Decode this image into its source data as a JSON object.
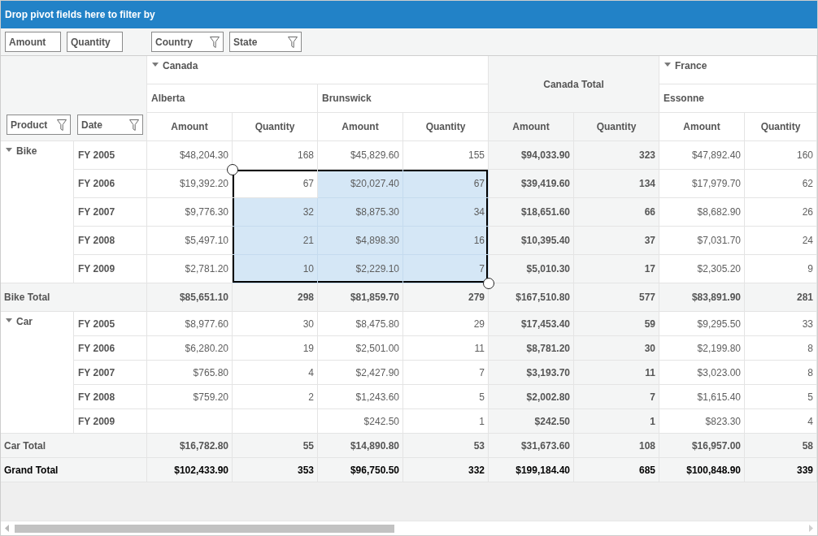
{
  "filter_area": {
    "title": "Drop pivot fields here to filter by"
  },
  "value_fields": [
    {
      "label": "Amount"
    },
    {
      "label": "Quantity"
    }
  ],
  "column_fields": [
    {
      "label": "Country"
    },
    {
      "label": "State"
    }
  ],
  "row_fields": [
    {
      "label": "Product"
    },
    {
      "label": "Date"
    }
  ],
  "column_groups": [
    {
      "kind": "country",
      "label": "Canada",
      "expanded": true,
      "states": [
        {
          "label": "Alberta",
          "measures": [
            "Amount",
            "Quantity"
          ]
        },
        {
          "label": "Brunswick",
          "measures": [
            "Amount",
            "Quantity"
          ]
        }
      ]
    },
    {
      "kind": "total",
      "label": "Canada Total",
      "measures": [
        "Amount",
        "Quantity"
      ]
    },
    {
      "kind": "country",
      "label": "France",
      "expanded": true,
      "states": [
        {
          "label": "Essonne",
          "measures": [
            "Amount",
            "Quantity"
          ]
        }
      ]
    }
  ],
  "row_groups": [
    {
      "label": "Bike",
      "expanded": true,
      "rows": [
        {
          "label": "FY 2005",
          "cells": [
            {
              "text": "$48,204.30",
              "selected": false
            },
            {
              "text": "168",
              "selected": false
            },
            {
              "text": "$45,829.60",
              "selected": false
            },
            {
              "text": "155",
              "selected": false
            },
            {
              "text": "$94,033.90",
              "selected": false
            },
            {
              "text": "323",
              "selected": false
            },
            {
              "text": "$47,892.40",
              "selected": false
            },
            {
              "text": "160",
              "selected": false
            }
          ]
        },
        {
          "label": "FY 2006",
          "cells": [
            {
              "text": "$19,392.20",
              "selected": false
            },
            {
              "text": "67",
              "selected": false
            },
            {
              "text": "$20,027.40",
              "selected": true
            },
            {
              "text": "67",
              "selected": true
            },
            {
              "text": "$39,419.60",
              "selected": false
            },
            {
              "text": "134",
              "selected": false
            },
            {
              "text": "$17,979.70",
              "selected": false
            },
            {
              "text": "62",
              "selected": false
            }
          ]
        },
        {
          "label": "FY 2007",
          "cells": [
            {
              "text": "$9,776.30",
              "selected": false
            },
            {
              "text": "32",
              "selected": true
            },
            {
              "text": "$8,875.30",
              "selected": true
            },
            {
              "text": "34",
              "selected": true
            },
            {
              "text": "$18,651.60",
              "selected": false
            },
            {
              "text": "66",
              "selected": false
            },
            {
              "text": "$8,682.90",
              "selected": false
            },
            {
              "text": "26",
              "selected": false
            }
          ]
        },
        {
          "label": "FY 2008",
          "cells": [
            {
              "text": "$5,497.10",
              "selected": false
            },
            {
              "text": "21",
              "selected": true
            },
            {
              "text": "$4,898.30",
              "selected": true
            },
            {
              "text": "16",
              "selected": true
            },
            {
              "text": "$10,395.40",
              "selected": false
            },
            {
              "text": "37",
              "selected": false
            },
            {
              "text": "$7,031.70",
              "selected": false
            },
            {
              "text": "24",
              "selected": false
            }
          ]
        },
        {
          "label": "FY 2009",
          "cells": [
            {
              "text": "$2,781.20",
              "selected": false
            },
            {
              "text": "10",
              "selected": true
            },
            {
              "text": "$2,229.10",
              "selected": true
            },
            {
              "text": "7",
              "selected": true
            },
            {
              "text": "$5,010.30",
              "selected": false
            },
            {
              "text": "17",
              "selected": false
            },
            {
              "text": "$2,305.20",
              "selected": false
            },
            {
              "text": "9",
              "selected": false
            }
          ]
        }
      ],
      "total": {
        "label": "Bike Total",
        "cells": [
          {
            "text": "$85,651.10",
            "selected": false
          },
          {
            "text": "298",
            "selected": false
          },
          {
            "text": "$81,859.70",
            "selected": false
          },
          {
            "text": "279",
            "selected": false
          },
          {
            "text": "$167,510.80",
            "selected": false
          },
          {
            "text": "577",
            "selected": false
          },
          {
            "text": "$83,891.90",
            "selected": false
          },
          {
            "text": "281",
            "selected": false
          }
        ]
      }
    },
    {
      "label": "Car",
      "expanded": true,
      "rows": [
        {
          "label": "FY 2005",
          "cells": [
            {
              "text": "$8,977.60",
              "selected": false
            },
            {
              "text": "30",
              "selected": false
            },
            {
              "text": "$8,475.80",
              "selected": false
            },
            {
              "text": "29",
              "selected": false
            },
            {
              "text": "$17,453.40",
              "selected": false
            },
            {
              "text": "59",
              "selected": false
            },
            {
              "text": "$9,295.50",
              "selected": false
            },
            {
              "text": "33",
              "selected": false
            }
          ]
        },
        {
          "label": "FY 2006",
          "cells": [
            {
              "text": "$6,280.20",
              "selected": false
            },
            {
              "text": "19",
              "selected": false
            },
            {
              "text": "$2,501.00",
              "selected": false
            },
            {
              "text": "11",
              "selected": false
            },
            {
              "text": "$8,781.20",
              "selected": false
            },
            {
              "text": "30",
              "selected": false
            },
            {
              "text": "$2,199.80",
              "selected": false
            },
            {
              "text": "8",
              "selected": false
            }
          ]
        },
        {
          "label": "FY 2007",
          "cells": [
            {
              "text": "$765.80",
              "selected": false
            },
            {
              "text": "4",
              "selected": false
            },
            {
              "text": "$2,427.90",
              "selected": false
            },
            {
              "text": "7",
              "selected": false
            },
            {
              "text": "$3,193.70",
              "selected": false
            },
            {
              "text": "11",
              "selected": false
            },
            {
              "text": "$3,023.00",
              "selected": false
            },
            {
              "text": "8",
              "selected": false
            }
          ]
        },
        {
          "label": "FY 2008",
          "cells": [
            {
              "text": "$759.20",
              "selected": false
            },
            {
              "text": "2",
              "selected": false
            },
            {
              "text": "$1,243.60",
              "selected": false
            },
            {
              "text": "5",
              "selected": false
            },
            {
              "text": "$2,002.80",
              "selected": false
            },
            {
              "text": "7",
              "selected": false
            },
            {
              "text": "$1,615.40",
              "selected": false
            },
            {
              "text": "5",
              "selected": false
            }
          ]
        },
        {
          "label": "FY 2009",
          "cells": [
            {
              "selected": false
            },
            {
              "selected": false
            },
            {
              "text": "$242.50",
              "selected": false
            },
            {
              "text": "1",
              "selected": false
            },
            {
              "text": "$242.50",
              "selected": false
            },
            {
              "text": "1",
              "selected": false
            },
            {
              "text": "$823.30",
              "selected": false
            },
            {
              "text": "4",
              "selected": false
            }
          ]
        }
      ],
      "total": {
        "label": "Car Total",
        "cells": [
          {
            "text": "$16,782.80",
            "selected": false
          },
          {
            "text": "55",
            "selected": false
          },
          {
            "text": "$14,890.80",
            "selected": false
          },
          {
            "text": "53",
            "selected": false
          },
          {
            "text": "$31,673.60",
            "selected": false
          },
          {
            "text": "108",
            "selected": false
          },
          {
            "text": "$16,957.00",
            "selected": false
          },
          {
            "text": "58",
            "selected": false
          }
        ]
      }
    }
  ],
  "grand_total": {
    "label": "Grand Total",
    "cells": [
      {
        "text": "$102,433.90",
        "selected": false
      },
      {
        "text": "353",
        "selected": false
      },
      {
        "text": "$96,750.50",
        "selected": false
      },
      {
        "text": "332",
        "selected": false
      },
      {
        "text": "$199,184.40",
        "selected": false
      },
      {
        "text": "685",
        "selected": false
      },
      {
        "text": "$100,848.90",
        "selected": false
      },
      {
        "text": "339",
        "selected": false
      }
    ]
  }
}
